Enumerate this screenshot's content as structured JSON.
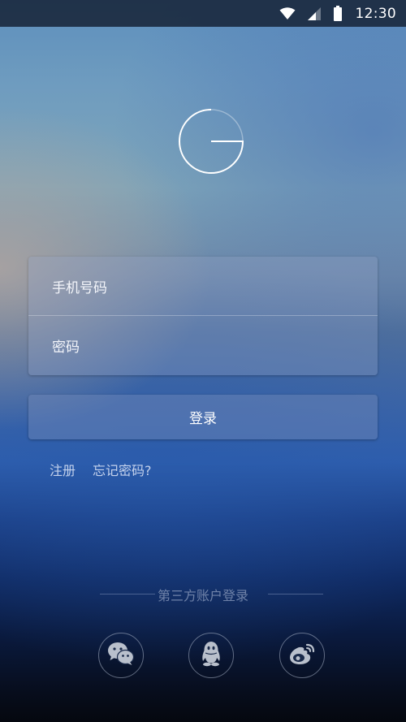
{
  "status_bar": {
    "time": "12:30",
    "icons": [
      "wifi-icon",
      "signal-icon",
      "battery-icon"
    ]
  },
  "logo": {
    "icon": "g-logo-icon"
  },
  "form": {
    "phone_placeholder": "手机号码",
    "password_placeholder": "密码",
    "login_label": "登录"
  },
  "links": {
    "register": "注册",
    "forgot_password": "忘记密码?"
  },
  "third_party": {
    "label": "第三方账户登录",
    "providers": [
      {
        "name": "wechat",
        "icon": "wechat-icon"
      },
      {
        "name": "qq",
        "icon": "qq-icon"
      },
      {
        "name": "weibo",
        "icon": "weibo-icon"
      }
    ]
  },
  "colors": {
    "link_text": "#c4d2ec",
    "divider_label": "#6f82a8",
    "social_icon": "#b9c0cc"
  }
}
